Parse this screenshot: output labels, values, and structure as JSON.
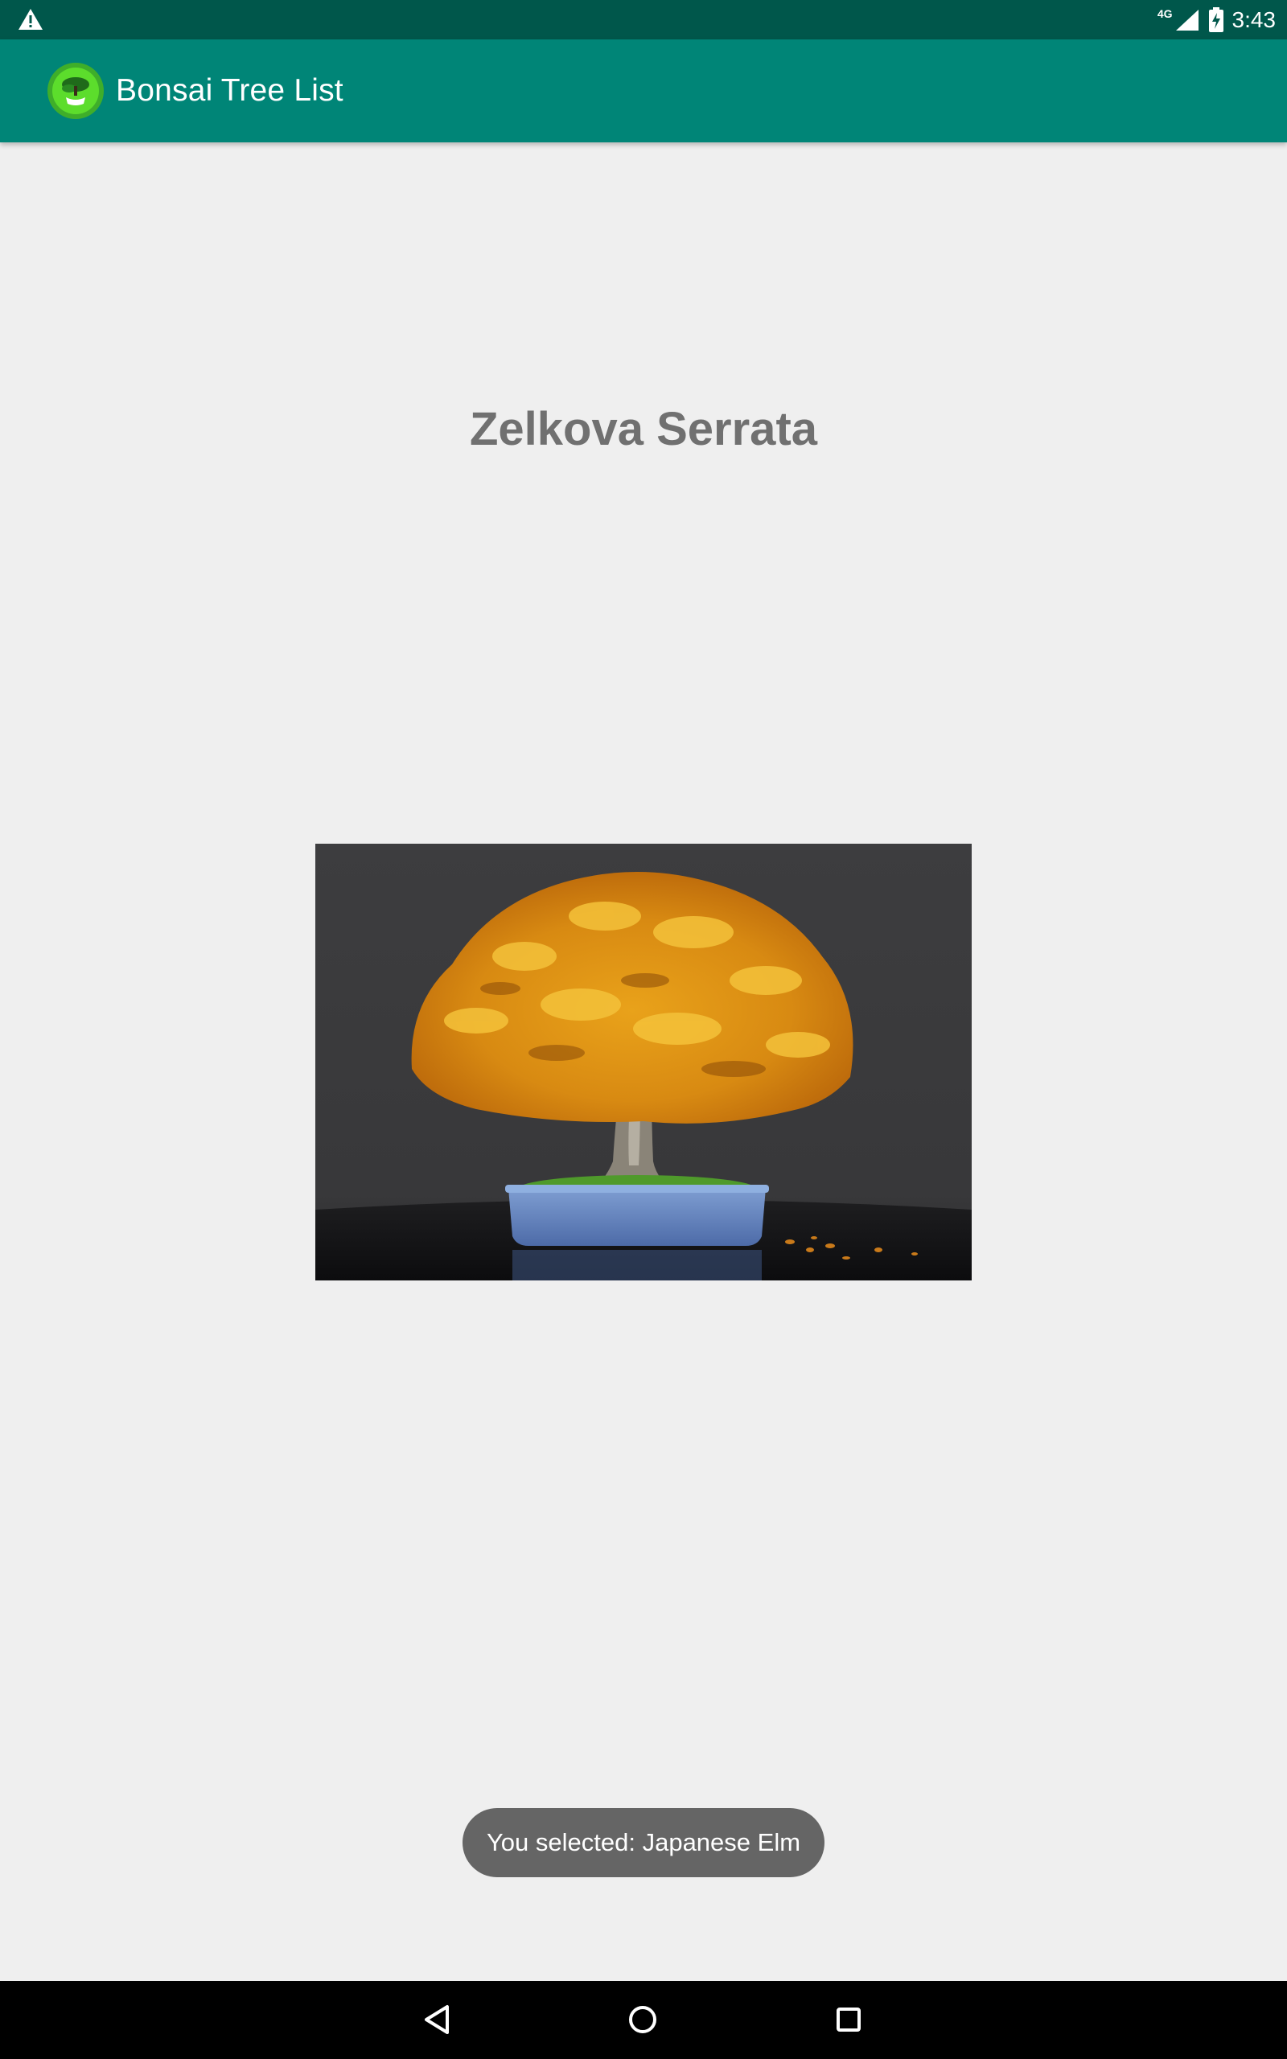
{
  "status_bar": {
    "network_label": "4G",
    "time": "3:43",
    "icons": [
      "warning-icon",
      "signal-icon",
      "battery-charging-icon"
    ]
  },
  "app_bar": {
    "title": "Bonsai Tree List",
    "logo_icon": "bonsai-logo-icon",
    "color": "#008577"
  },
  "detail": {
    "tree_name": "Zelkova Serrata",
    "image_icon": "bonsai-photo"
  },
  "toast": {
    "message": "You selected: Japanese Elm"
  },
  "navigation": {
    "buttons": [
      "back-icon",
      "home-icon",
      "recent-apps-icon"
    ]
  },
  "colors": {
    "status_bar": "#00574b",
    "app_bar": "#008577",
    "background": "#efefef",
    "title_text": "#707070",
    "toast": "#656565"
  }
}
